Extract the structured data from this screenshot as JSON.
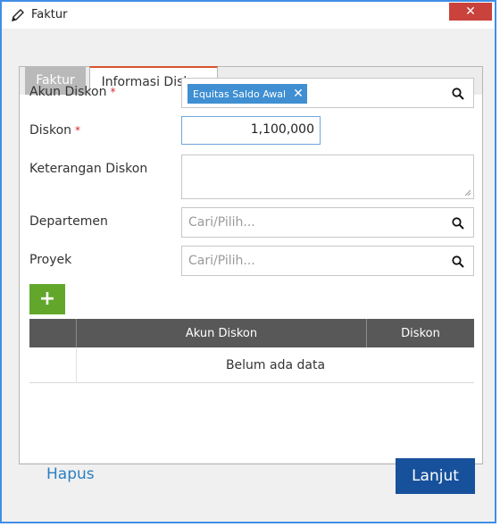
{
  "window": {
    "title": "Faktur",
    "close_glyph": "✕",
    "accent_color": "#3f8fe6"
  },
  "tabs": [
    {
      "label": "Faktur",
      "active": false
    },
    {
      "label": "Informasi Diskon",
      "active": true
    }
  ],
  "form": {
    "akun_diskon": {
      "label": "Akun Diskon",
      "required_mark": "*",
      "tag": "Equitas Saldo Awal",
      "tag_remove": "✕"
    },
    "diskon": {
      "label": "Diskon",
      "required_mark": "*",
      "value": "1,100,000"
    },
    "keterangan": {
      "label": "Keterangan Diskon",
      "value": ""
    },
    "departemen": {
      "label": "Departemen",
      "placeholder": "Cari/Pilih..."
    },
    "proyek": {
      "label": "Proyek",
      "placeholder": "Cari/Pilih..."
    }
  },
  "table": {
    "add_glyph": "+",
    "columns": [
      "",
      "Akun Diskon",
      "Diskon"
    ],
    "empty_text": "Belum ada data"
  },
  "footer": {
    "delete_label": "Hapus",
    "next_label": "Lanjut"
  },
  "icons": {
    "title": "pencil-icon",
    "search": "search-icon",
    "close": "close-icon",
    "add": "plus-icon"
  }
}
